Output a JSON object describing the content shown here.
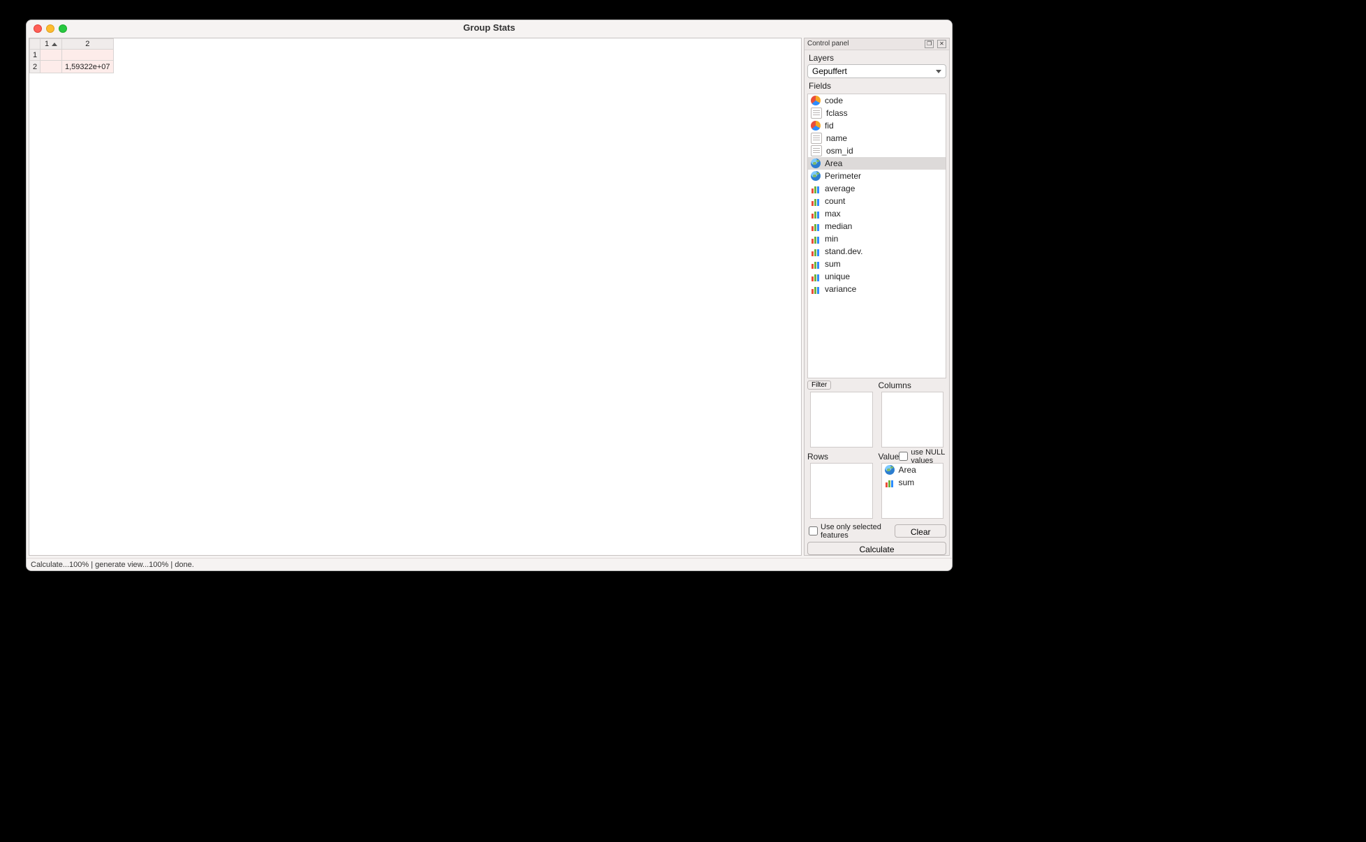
{
  "window": {
    "title": "Group Stats"
  },
  "panel": {
    "title": "Control panel",
    "layers_label": "Layers",
    "layer_selected": "Gepuffert",
    "fields_label": "Fields",
    "filter_label": "Filter",
    "columns_label": "Columns",
    "rows_label": "Rows",
    "value_label": "Value",
    "null_label": "use NULL values",
    "only_sel_label": "Use only selected features",
    "clear_label": "Clear",
    "calculate_label": "Calculate"
  },
  "fields": [
    {
      "label": "code",
      "icon": "pie"
    },
    {
      "label": "fclass",
      "icon": "txt"
    },
    {
      "label": "fid",
      "icon": "pie"
    },
    {
      "label": "name",
      "icon": "txt"
    },
    {
      "label": "osm_id",
      "icon": "txt"
    },
    {
      "label": "Area",
      "icon": "globe",
      "selected": true
    },
    {
      "label": "Perimeter",
      "icon": "globe"
    },
    {
      "label": "average",
      "icon": "bar"
    },
    {
      "label": "count",
      "icon": "bar"
    },
    {
      "label": "max",
      "icon": "bar"
    },
    {
      "label": "median",
      "icon": "bar"
    },
    {
      "label": "min",
      "icon": "bar"
    },
    {
      "label": "stand.dev.",
      "icon": "bar"
    },
    {
      "label": "sum",
      "icon": "bar"
    },
    {
      "label": "unique",
      "icon": "bar"
    },
    {
      "label": "variance",
      "icon": "bar"
    }
  ],
  "value_items": [
    {
      "label": "Area",
      "icon": "globe"
    },
    {
      "label": "sum",
      "icon": "bar"
    }
  ],
  "table": {
    "col_headers": [
      "1",
      "2"
    ],
    "rows": [
      {
        "header": "1",
        "cells": [
          "",
          ""
        ]
      },
      {
        "header": "2",
        "cells": [
          "",
          "1,59322e+07"
        ]
      }
    ],
    "sorted_col": 0
  },
  "status": "Calculate...100% |  generate view...100% |  done."
}
